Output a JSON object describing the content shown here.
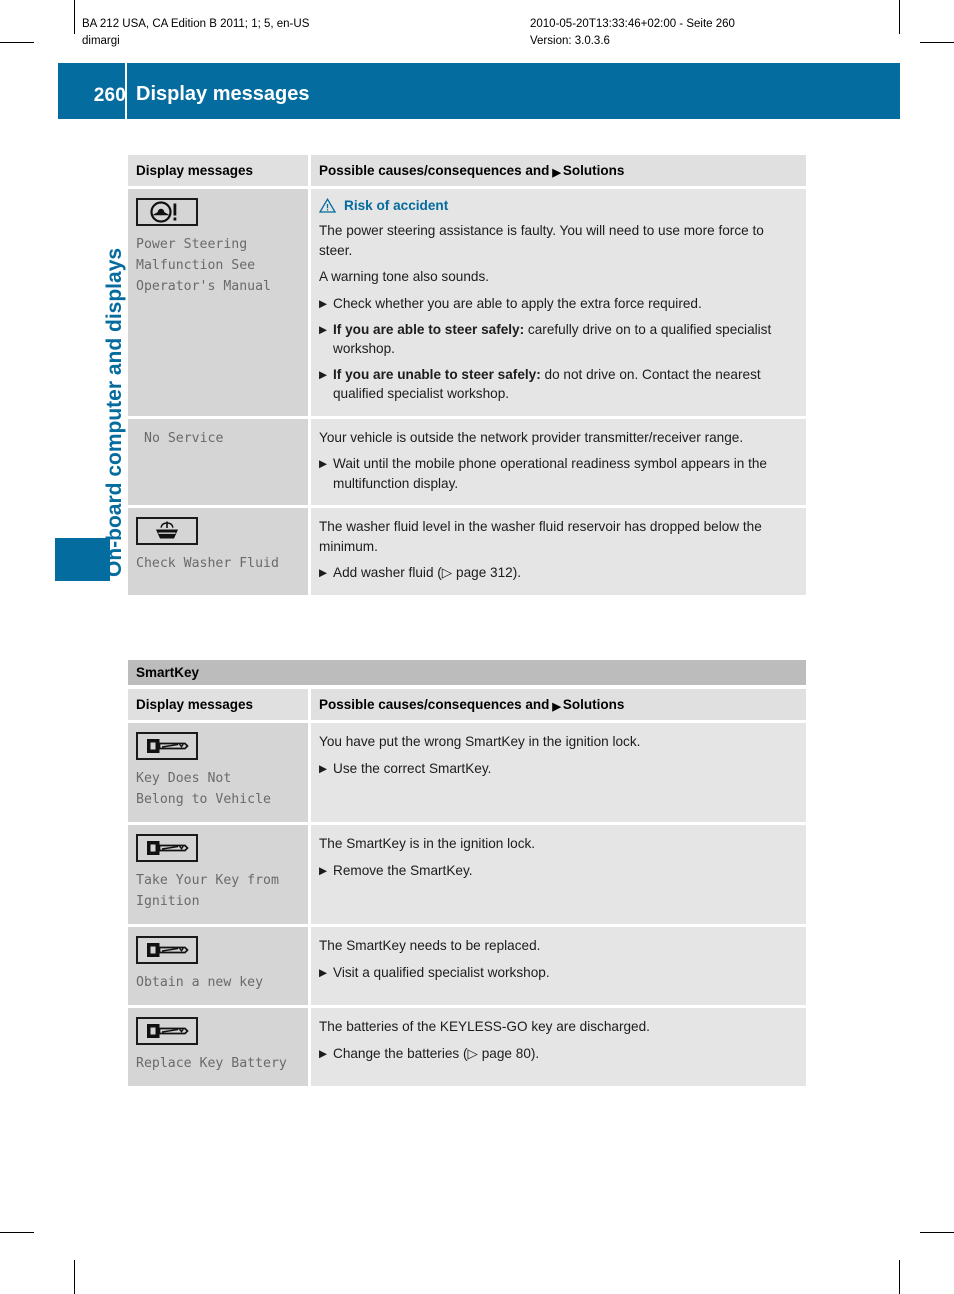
{
  "print_header": {
    "left_line1": "BA 212 USA, CA Edition B 2011; 1; 5, en-US",
    "left_line2": "dimargi",
    "right_line1": "2010-05-20T13:33:46+02:00 - Seite 260",
    "right_line2": "Version: 3.0.3.6"
  },
  "banner": {
    "page_number": "260",
    "title": "Display messages",
    "color": "#046c9e"
  },
  "chapter_tab": {
    "label": "On-board computer and displays",
    "color": "#046c9e"
  },
  "tables": [
    {
      "id": "warnings",
      "section_label": null,
      "header": {
        "col1": "Display messages",
        "col2_before": "Possible causes/consequences and",
        "col2_arrow": "▶",
        "col2_after": "Solutions"
      },
      "rows": [
        {
          "icon": "steering-wheel-warning-icon",
          "message": "Power Steering\nMalfunction See\nOperator's Manual",
          "warning": {
            "icon": "warning-triangle-icon",
            "label": "Risk of accident",
            "color": "#046c9e"
          },
          "paragraphs": [
            "The power steering assistance is faulty. You will need to use more force to steer.",
            "A warning tone also sounds."
          ],
          "steps": [
            {
              "bold": "",
              "text": "Check whether you are able to apply the extra force required."
            },
            {
              "bold": "If you are able to steer safely:",
              "text": " carefully drive on to a qualified specialist workshop."
            },
            {
              "bold": "If you are unable to steer safely:",
              "text": " do not drive on. Contact the nearest qualified specialist workshop."
            }
          ]
        },
        {
          "icon": null,
          "message": "No Service",
          "message_indent": true,
          "paragraphs": [
            "Your vehicle is outside the network provider transmitter/receiver range."
          ],
          "steps": [
            {
              "bold": "",
              "text": "Wait until the mobile phone operational readiness symbol appears in the multifunction display."
            }
          ]
        },
        {
          "icon": "washer-fluid-icon",
          "message": "Check Washer Fluid",
          "paragraphs": [
            "The washer fluid level in the washer fluid reservoir has dropped below the minimum."
          ],
          "steps": [
            {
              "bold": "",
              "text": "Add washer fluid (▷ page 312)."
            }
          ]
        }
      ]
    },
    {
      "id": "smartkey",
      "section_label": "SmartKey",
      "header": {
        "col1": "Display messages",
        "col2_before": "Possible causes/consequences and",
        "col2_arrow": "▶",
        "col2_after": "Solutions"
      },
      "rows": [
        {
          "icon": "smartkey-icon",
          "message": "Key Does Not\nBelong to Vehicle",
          "paragraphs": [
            "You have put the wrong SmartKey in the ignition lock."
          ],
          "steps": [
            {
              "bold": "",
              "text": "Use the correct SmartKey."
            }
          ]
        },
        {
          "icon": "smartkey-icon",
          "message": "Take Your Key from\nIgnition",
          "paragraphs": [
            "The SmartKey is in the ignition lock."
          ],
          "steps": [
            {
              "bold": "",
              "text": "Remove the SmartKey."
            }
          ]
        },
        {
          "icon": "smartkey-icon",
          "message": "Obtain a new key",
          "paragraphs": [
            "The SmartKey needs to be replaced."
          ],
          "steps": [
            {
              "bold": "",
              "text": "Visit a qualified specialist workshop."
            }
          ]
        },
        {
          "icon": "smartkey-icon",
          "message": "Replace Key Battery",
          "paragraphs": [
            "The batteries of the KEYLESS-GO key are discharged."
          ],
          "steps": [
            {
              "bold": "",
              "text": "Change the batteries (▷ page 80)."
            }
          ]
        }
      ]
    }
  ]
}
